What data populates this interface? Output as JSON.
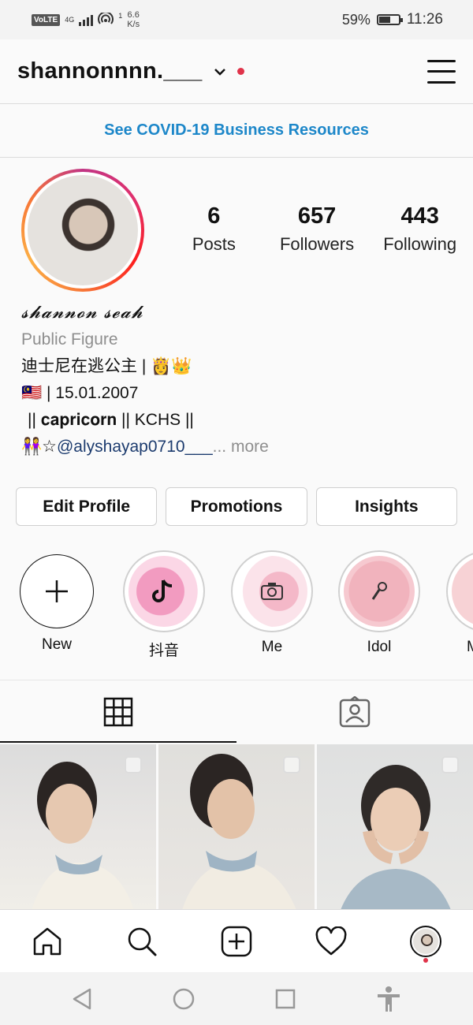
{
  "status_bar": {
    "volte": "VoLTE",
    "network": "4G",
    "sim_index": "1",
    "speed_value": "6.6",
    "speed_unit": "K/s",
    "battery": "59%",
    "battery_level": 0.59,
    "time": "11:26"
  },
  "header": {
    "username": "shannonnnn.___"
  },
  "covid_link": "See COVID-19 Business Resources",
  "profile": {
    "stats": [
      {
        "value": "6",
        "label": "Posts"
      },
      {
        "value": "657",
        "label": "Followers"
      },
      {
        "value": "443",
        "label": "Following"
      }
    ],
    "display_name": "𝓼𝓱𝓪𝓷𝓷𝓸𝓷 𝓼𝓮𝓪𝓱",
    "category": "Public Figure",
    "bio_line1": "迪士尼在逃公主 | 👸👑",
    "bio_line2": "🇲🇾 | 15.01.2007",
    "bio_line3": "|| 𝐜𝐚𝐩𝐫𝐢𝐜𝐨𝐫𝐧 || KCHS ||",
    "bio_line4_prefix": "👭☆",
    "bio_line4_mention": "@alyshayap0710___",
    "bio_line4_more": "... more"
  },
  "buttons": {
    "edit_profile": "Edit Profile",
    "promotions": "Promotions",
    "insights": "Insights"
  },
  "highlights": [
    {
      "label": "New"
    },
    {
      "label": "抖音"
    },
    {
      "label": "Me"
    },
    {
      "label": "Idol"
    },
    {
      "label": "M"
    }
  ],
  "icons": {
    "header": [
      "chevron-down-icon",
      "menu-icon"
    ],
    "tabs": [
      "grid-icon",
      "tagged-icon"
    ],
    "bottom_nav": [
      "home-icon",
      "search-icon",
      "add-post-icon",
      "heart-icon",
      "profile-avatar"
    ],
    "system_nav": [
      "back-icon",
      "home-circle-icon",
      "recents-icon",
      "accessibility-icon"
    ]
  },
  "colors": {
    "link_blue": "#1d87c9",
    "notification_red": "#e0334a",
    "mention_blue": "#1c3b6e"
  }
}
